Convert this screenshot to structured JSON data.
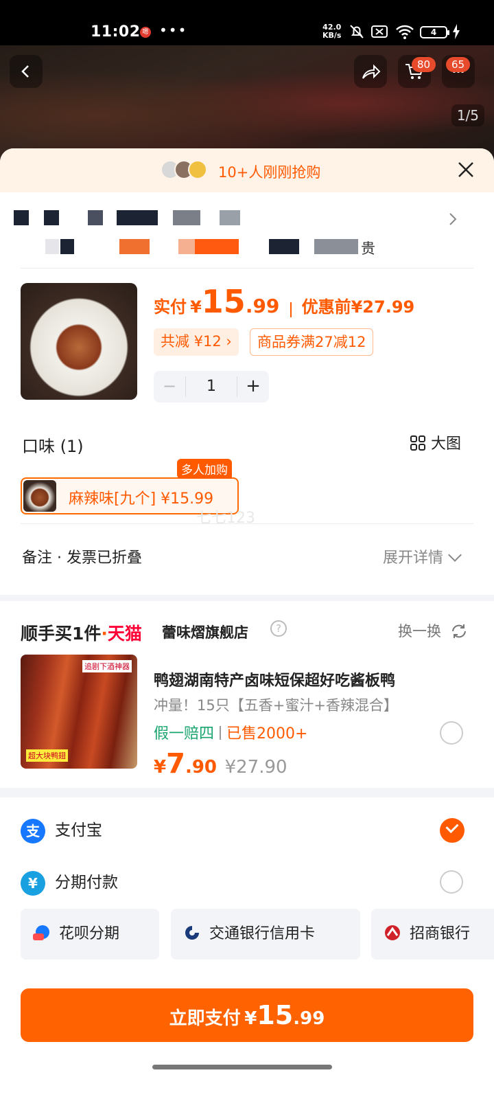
{
  "status_bar": {
    "time": "11:02",
    "app_dot": "嗯",
    "more": "•••",
    "net_speed_value": "42.0",
    "net_speed_unit": "KB/s",
    "battery": "4"
  },
  "hero": {
    "cart_badge": "80",
    "msg_badge": "65",
    "page_indicator": "1/5"
  },
  "banner": {
    "text": "10+人刚刚抢购"
  },
  "redacted_suffix": "贵",
  "product": {
    "pay_label": "实付",
    "currency": "¥",
    "price_int": "15",
    "price_dec": ".99",
    "before_label": "优惠前",
    "before_price": "¥27.99",
    "discount_tag": "共减 ¥12 ›",
    "coupon_tag": "商品券满27减12",
    "qty_minus": "−",
    "quantity": "1",
    "qty_plus": "+"
  },
  "flavor": {
    "title": "口味 (1)",
    "big_pic_label": "大图",
    "option_label": "麻辣味[九个]",
    "option_price": "¥15.99",
    "option_badge": "多人加购",
    "watermark": "七七123"
  },
  "note": {
    "label": "备注 · 发票已折叠",
    "expand": "展开详情"
  },
  "recommend": {
    "logo": "顺手买1件",
    "dot": "·",
    "tmall": "天猫",
    "shop": "蕾味熠旗舰店",
    "help": "?",
    "swap": "换一换",
    "img_caption_top": "追剧下酒神器",
    "img_caption_bottom": "超大块鸭翅",
    "title": "鸭翅湖南特产卤味短保超好吃酱板鸭",
    "subtitle": "冲量！15只【五香+蜜汁+香辣混合】",
    "tag_a": "假一赔四",
    "tag_b": "已售2000+",
    "currency": "¥",
    "price_int": "7",
    "price_dec": ".90",
    "old_price": "¥27.90"
  },
  "payment": {
    "alipay_icon": "支",
    "alipay": "支付宝",
    "installment_icon": "¥",
    "installment": "分期付款",
    "chip_huabei": "花呗分期",
    "chip_bocom": "交通银行信用卡",
    "chip_cmb": "招商银行"
  },
  "pay_button": {
    "label": "立即支付",
    "currency": "¥",
    "price_int": "15",
    "price_dec": ".99"
  },
  "colors": {
    "accent": "#ff5a00",
    "button": "#ff6200",
    "green": "#1aa56e",
    "tmall_red": "#ff0036"
  }
}
